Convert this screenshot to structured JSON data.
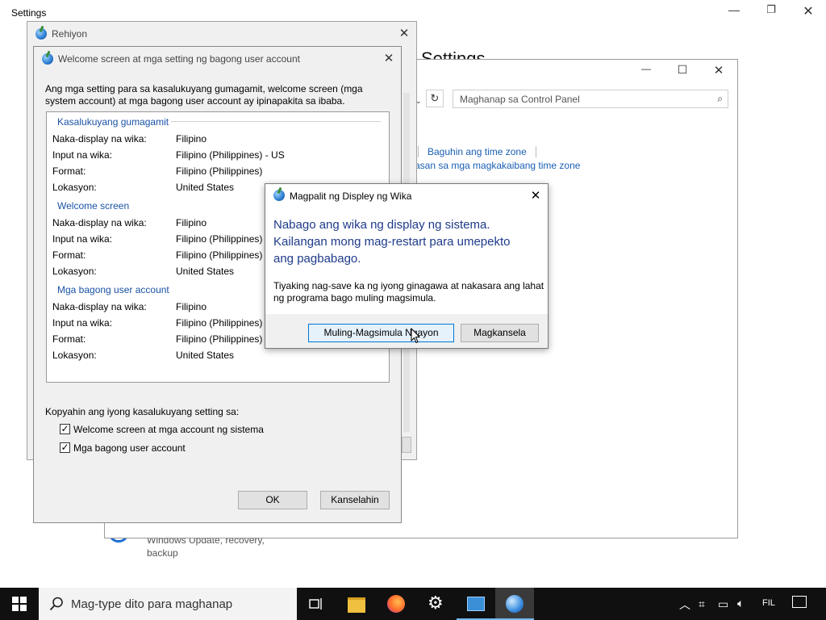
{
  "settings": {
    "title": "Settings",
    "heading": "Settings",
    "snippet1": "Windows Update, recovery,",
    "snippet2": "backup"
  },
  "control_panel": {
    "search_placeholder": "Maghanap sa Control Panel",
    "link1": "Baguhin ang time zone",
    "link2": "asan sa mga magkakaibang  time zone"
  },
  "rehiyon": {
    "title": "Rehiyon"
  },
  "welcome": {
    "title": "Welcome screen at mga setting ng bagong user account",
    "intro1": "Ang mga setting para sa kasalukuyang gumagamit, welcome screen (mga",
    "intro2": "system account) at mga bagong user account ay ipinapakita sa ibaba.",
    "groups": [
      {
        "title": "Kasalukuyang gumagamit",
        "rows": [
          {
            "label": "Naka-display na wika:",
            "value": "Filipino"
          },
          {
            "label": "Input na wika:",
            "value": "Filipino (Philippines) - US"
          },
          {
            "label": "Format:",
            "value": "Filipino (Philippines)"
          },
          {
            "label": "Lokasyon:",
            "value": "United States"
          }
        ]
      },
      {
        "title": "Welcome screen",
        "rows": [
          {
            "label": "Naka-display na wika:",
            "value": "Filipino"
          },
          {
            "label": "Input na wika:",
            "value": "Filipino (Philippines)"
          },
          {
            "label": "Format:",
            "value": "Filipino (Philippines)"
          },
          {
            "label": "Lokasyon:",
            "value": "United States"
          }
        ]
      },
      {
        "title": "Mga bagong user account",
        "rows": [
          {
            "label": "Naka-display na wika:",
            "value": "Filipino"
          },
          {
            "label": "Input na wika:",
            "value": "Filipino (Philippines)"
          },
          {
            "label": "Format:",
            "value": "Filipino (Philippines)"
          },
          {
            "label": "Lokasyon:",
            "value": "United States"
          }
        ]
      }
    ],
    "copy_label": "Kopyahin ang iyong kasalukuyang setting sa:",
    "chk1": "Welcome screen at mga account ng sistema",
    "chk2": "Mga bagong user account",
    "ok": "OK",
    "cancel": "Kanselahin"
  },
  "dialog": {
    "title": "Magpalit ng Displey ng Wika",
    "main1": "Nabago ang wika ng display ng sistema.",
    "main2": "Kailangan mong mag-restart para umepekto",
    "main3": "ang pagbabago.",
    "sub1": "Tiyaking nag-save ka ng iyong ginagawa at nakasara ang lahat",
    "sub2": "ng programa bago muling magsimula.",
    "restart": "Muling-Magsimula Ngayon",
    "cancel": "Magkansela"
  },
  "taskbar": {
    "search_placeholder": "Mag-type dito para maghanap",
    "lang": "FIL"
  },
  "colors": {
    "accent": "#0078d7",
    "link": "#1a5fb4",
    "group": "#1a52a6",
    "dialog_main": "#1e3a8a",
    "taskbar": "#101010"
  }
}
